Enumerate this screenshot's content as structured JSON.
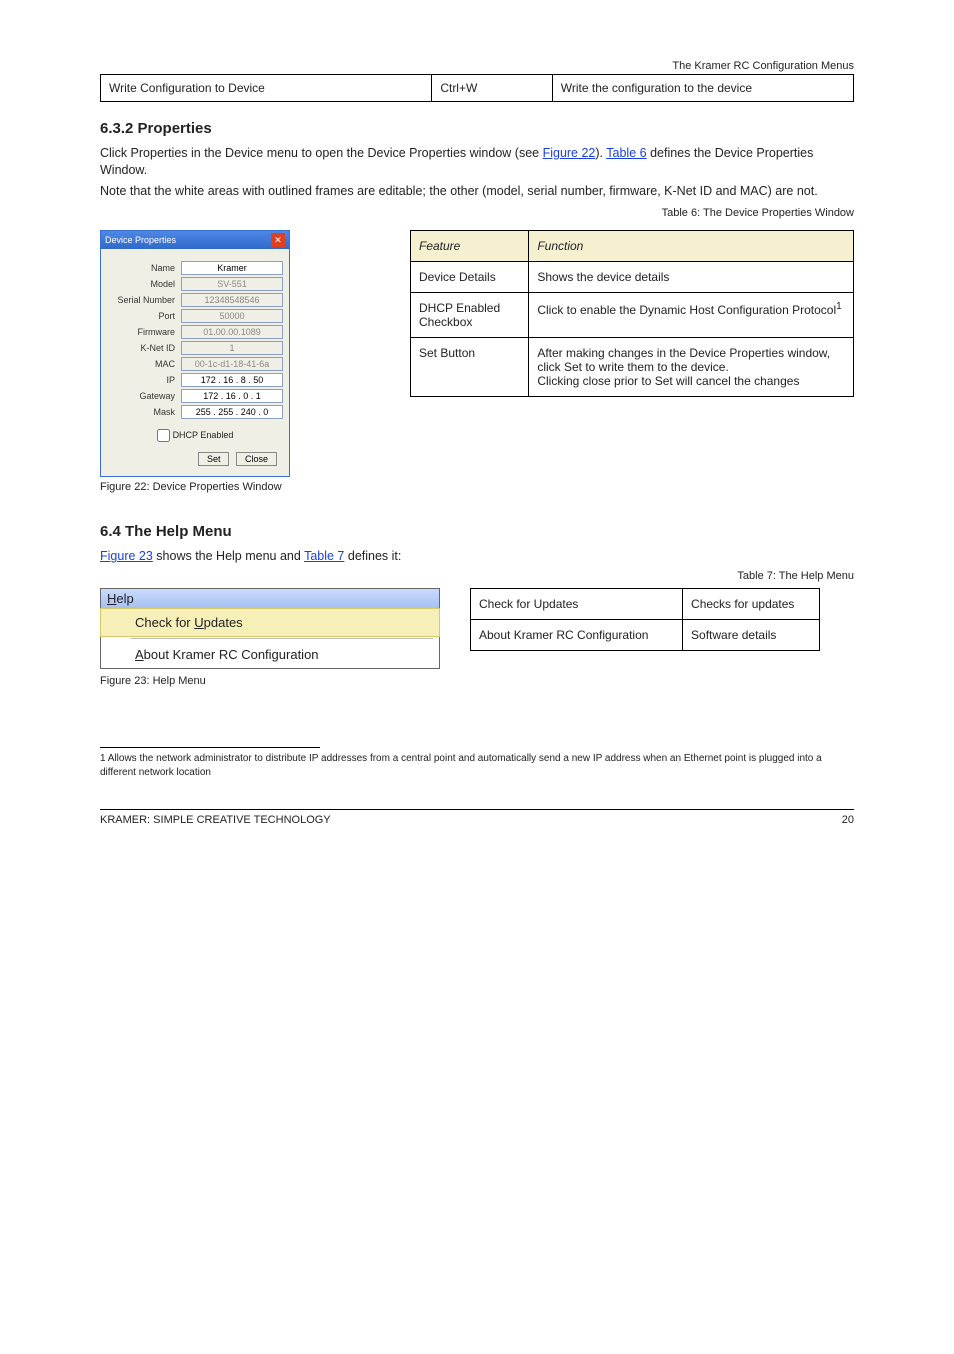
{
  "header": {
    "running": "The Kramer RC Configuration Menus"
  },
  "top_row": {
    "c1": "Write Configuration to Device",
    "c2": "Ctrl+W",
    "c3": "Write the configuration to the device"
  },
  "sec_props": {
    "title": "6.3.2 Properties",
    "p1_a": "Click Properties in the Device menu to open the Device Properties window (see ",
    "p1_link1": "Figure 22",
    "p1_b": "). ",
    "p1_link2": "Table 6",
    "p1_c": " defines the Device Properties Window.",
    "p2": "Note that the white areas with outlined frames are editable; the other (model, serial number, firmware, K-Net ID and MAC) are not.",
    "table_caption": "Table 6: The Device Properties Window",
    "tbl": {
      "h1": "Feature",
      "h2": "Function",
      "r1a": "Device Details",
      "r1b": "Shows the device details",
      "r2a": "DHCP Enabled Checkbox",
      "r2b": "Click to enable the Dynamic Host Configuration Protocol",
      "r2note": "1",
      "r3a": "Set Button",
      "r3b_1": "After making changes in the Device Properties window, click Set to write them to the device.",
      "r3b_2": "Clicking close prior to Set will cancel the changes"
    },
    "fig_caption": "Figure 22: Device Properties Window",
    "dlg": {
      "title": "Device Properties",
      "name_l": "Name",
      "name_v": "Kramer",
      "model_l": "Model",
      "model_v": "SV-551",
      "sn_l": "Serial Number",
      "sn_v": "12348548546",
      "port_l": "Port",
      "port_v": "50000",
      "fw_l": "Firmware",
      "fw_v": "01.00.00.1089",
      "knet_l": "K-Net ID",
      "knet_v": "1",
      "mac_l": "MAC",
      "mac_v": "00-1c-d1-18-41-6a",
      "ip_l": "IP",
      "ip_v": "172 . 16 . 8 . 50",
      "gw_l": "Gateway",
      "gw_v": "172 . 16 . 0 . 1",
      "mask_l": "Mask",
      "mask_v": "255 . 255 . 240 . 0",
      "dhcp": "DHCP Enabled",
      "set": "Set",
      "close": "Close"
    }
  },
  "sec_help": {
    "title": "6.4 The Help Menu",
    "p_a": "",
    "p_link1": "Figure 23",
    "p_b": " shows the Help menu and ",
    "p_link2": "Table 7",
    "p_c": " defines it:",
    "menu": {
      "bar_pre": "H",
      "bar_txt": "elp",
      "item1_pre": "Check for ",
      "item1_u": "U",
      "item1_post": "pdates",
      "item2_u": "A",
      "item2_post": "bout Kramer RC Configuration"
    },
    "tbl": {
      "r1a": "Check for Updates",
      "r1b": "Checks for updates",
      "r2a": "About Kramer RC Configuration",
      "r2b": "Software details"
    },
    "fig_caption": "Figure 23: Help Menu",
    "table_caption": "Table 7: The Help Menu"
  },
  "footnote": "1 Allows the network administrator to distribute IP addresses from a central point and automatically send a new IP address when an Ethernet point is plugged into a different network location",
  "footer": {
    "left": "KRAMER: SIMPLE CREATIVE TECHNOLOGY",
    "right": "20"
  }
}
